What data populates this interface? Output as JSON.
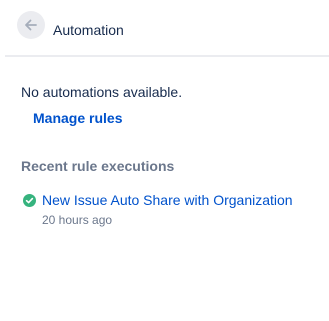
{
  "header": {
    "title": "Automation",
    "back_icon": "arrow-left-icon"
  },
  "main": {
    "empty_message": "No automations available.",
    "manage_rules_label": "Manage rules"
  },
  "recent": {
    "heading": "Recent rule executions",
    "items": [
      {
        "name": "New Issue Auto Share with Organization",
        "time": "20 hours ago",
        "status_icon": "check-circle-icon",
        "status_color": "#36B37E"
      }
    ]
  },
  "colors": {
    "link": "#0052CC",
    "text": "#172B4D",
    "subtle": "#6B778C",
    "success": "#36B37E"
  }
}
